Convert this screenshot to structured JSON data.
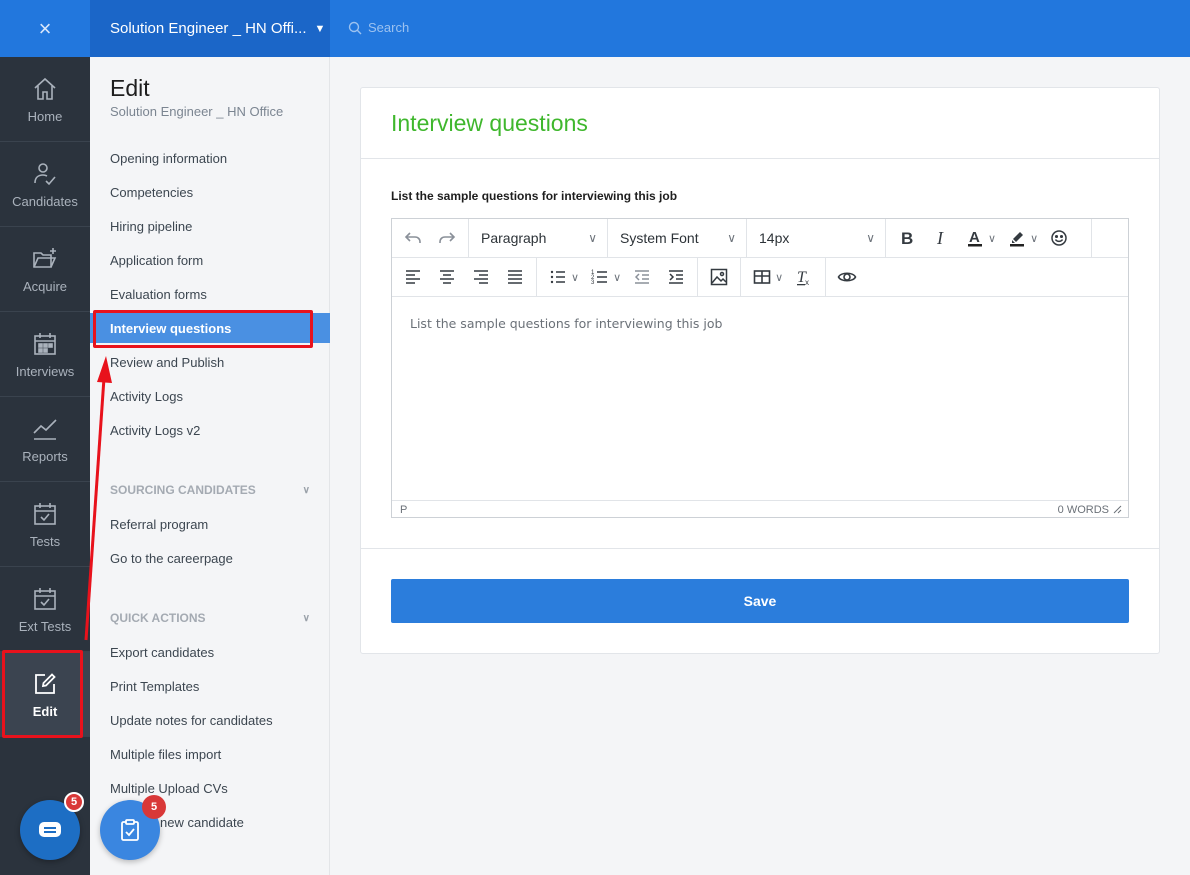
{
  "topbar": {
    "close_glyph": "×",
    "job_title": "Solution Engineer _ HN Offi...",
    "search_placeholder": "Search"
  },
  "rail": {
    "items": [
      {
        "label": "Home",
        "icon": "home-icon"
      },
      {
        "label": "Candidates",
        "icon": "candidates-icon"
      },
      {
        "label": "Acquire",
        "icon": "acquire-folder-icon"
      },
      {
        "label": "Interviews",
        "icon": "calendar-icon"
      },
      {
        "label": "Reports",
        "icon": "chart-line-icon"
      },
      {
        "label": "Tests",
        "icon": "test-calendar-icon"
      },
      {
        "label": "Ext Tests",
        "icon": "ext-test-calendar-icon"
      },
      {
        "label": "Edit",
        "icon": "edit-icon"
      }
    ],
    "active": "Edit"
  },
  "subnav": {
    "title": "Edit",
    "subtitle": "Solution Engineer _ HN Office",
    "links": [
      "Opening information",
      "Competencies",
      "Hiring pipeline",
      "Application form",
      "Evaluation forms",
      "Interview questions",
      "Review and Publish",
      "Activity Logs",
      "Activity Logs v2"
    ],
    "active_link": "Interview questions",
    "sourcing": {
      "heading": "SOURCING CANDIDATES",
      "links": [
        "Referral program",
        "Go to the careerpage"
      ]
    },
    "quick_actions": {
      "heading": "QUICK ACTIONS",
      "links": [
        "Export candidates",
        "Print Templates",
        "Update notes for candidates",
        "Multiple files import",
        "Multiple Upload CVs",
        "new candidate"
      ]
    }
  },
  "main": {
    "title": "Interview questions",
    "field_label": "List the sample questions for interviewing this job",
    "editor": {
      "block_format": "Paragraph",
      "font_family": "System Font",
      "font_size": "14px",
      "placeholder": "List the sample questions for interviewing this job",
      "status_path": "P",
      "word_count": "0 WORDS"
    },
    "save_label": "Save"
  },
  "fabs": {
    "chat_badge": "5",
    "tasks_badge": "5"
  },
  "colors": {
    "topbar": "#2277dd",
    "rail": "#2b333d",
    "title_green": "#3fb72d",
    "primary": "#2b7ddc",
    "annotation_red": "#e8121c"
  }
}
